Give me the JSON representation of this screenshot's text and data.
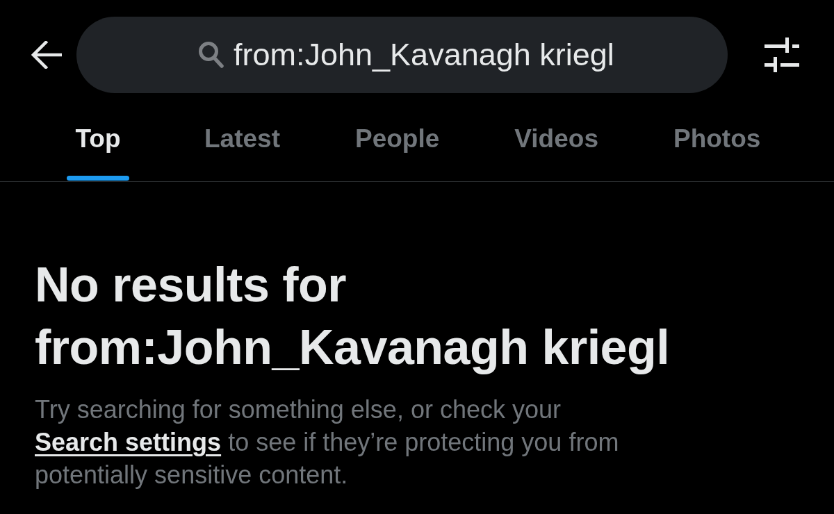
{
  "search": {
    "value": "from:John_Kavanagh kriegl"
  },
  "tabs": [
    {
      "label": "Top",
      "selected": true
    },
    {
      "label": "Latest",
      "selected": false
    },
    {
      "label": "People",
      "selected": false
    },
    {
      "label": "Videos",
      "selected": false
    },
    {
      "label": "Photos",
      "selected": false
    }
  ],
  "empty_state": {
    "title": "No results for from:John_Kavanagh kriegl",
    "text_before": "Try searching for something else, or check your",
    "link": "Search settings",
    "text_after": "to see if they’re protecting you from potentially sensitive content."
  }
}
